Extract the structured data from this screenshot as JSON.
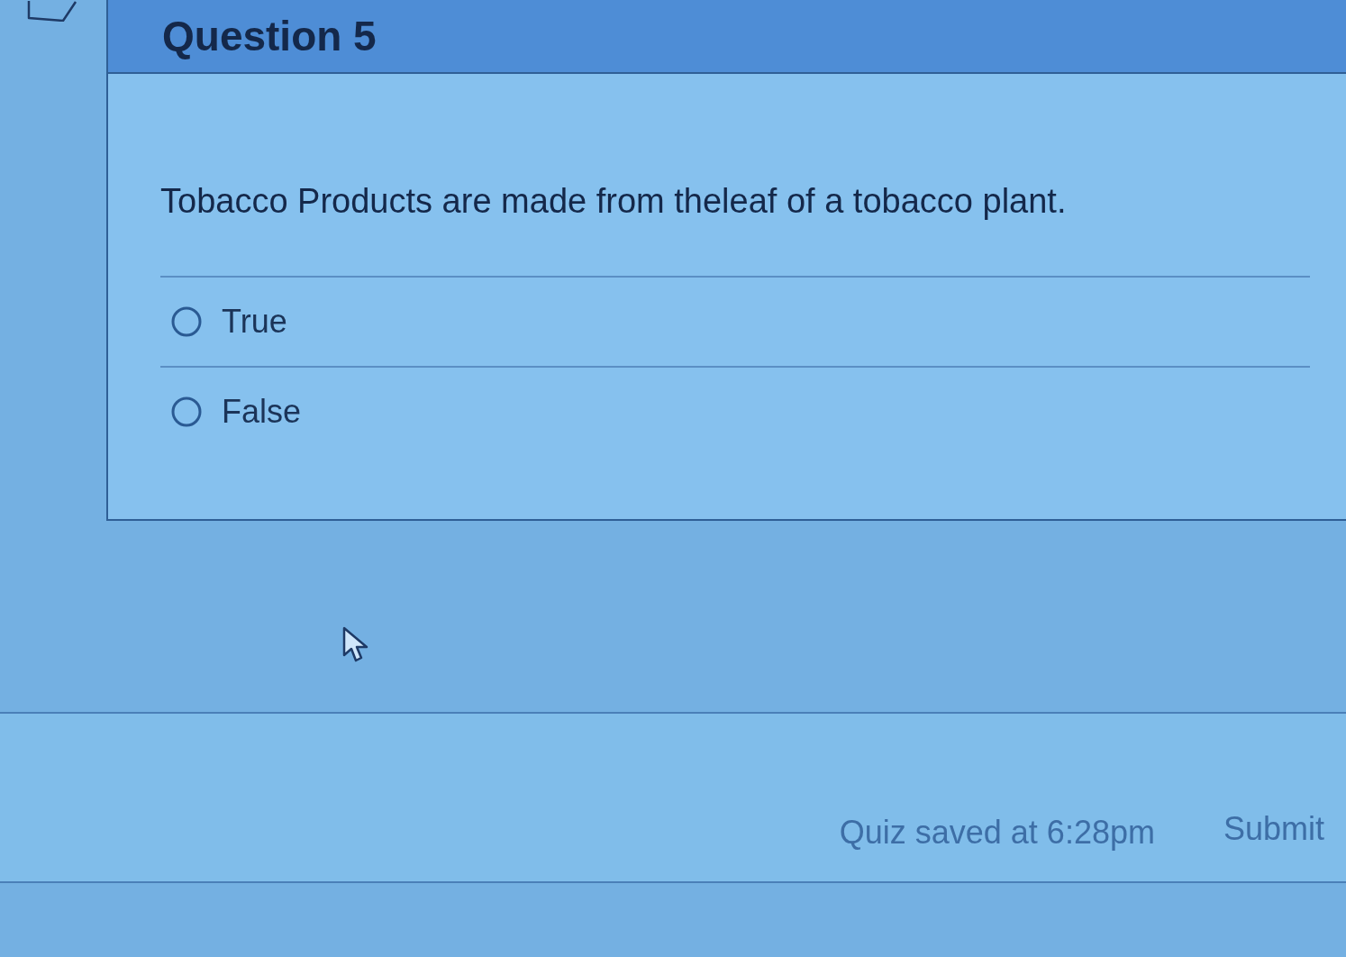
{
  "question": {
    "flagged": false,
    "title": "Question 5",
    "text": "Tobacco Products are made from theleaf of a tobacco plant.",
    "answers": [
      {
        "label": "True",
        "selected": false
      },
      {
        "label": "False",
        "selected": false
      }
    ]
  },
  "footer": {
    "status": "Quiz saved at 6:28pm",
    "submit_button": "Submit"
  }
}
